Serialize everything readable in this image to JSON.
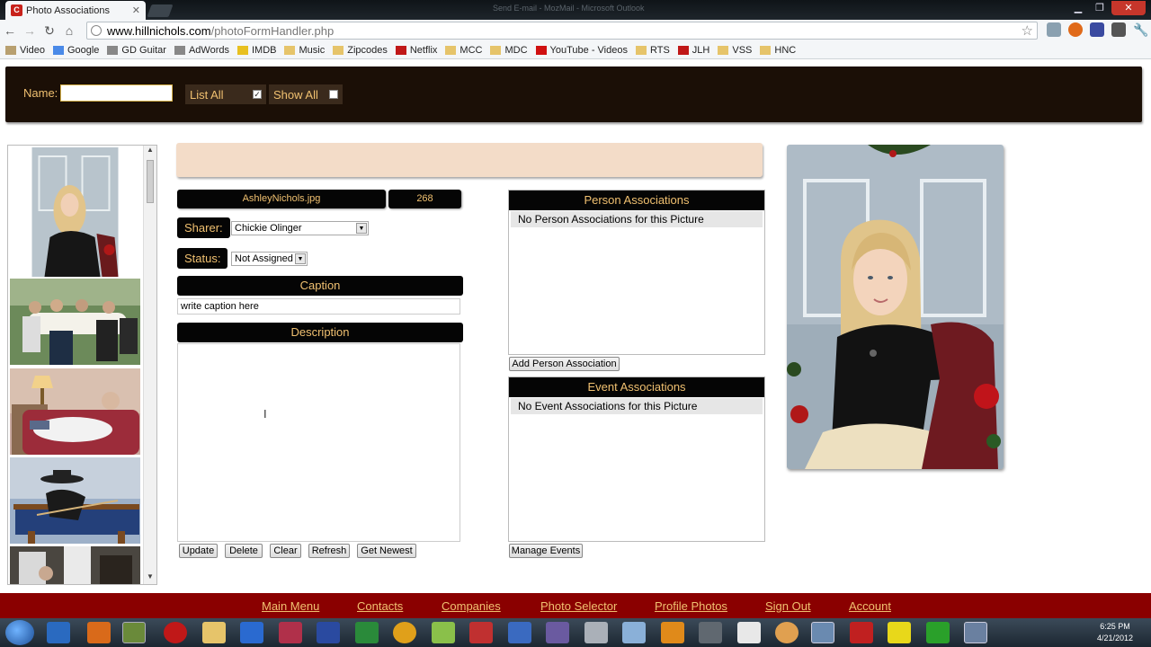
{
  "browser": {
    "tab_title": "Photo Associations",
    "background_title": "Send E-mail - MozMail - Microsoft Outlook",
    "url_host": "www.hillnichols.com",
    "url_path": "/photoFormHandler.php",
    "bookmarks": [
      "Video",
      "Google",
      "GD Guitar",
      "AdWords",
      "IMDB",
      "Music",
      "Zipcodes",
      "Netflix",
      "MCC",
      "MDC",
      "YouTube - Videos",
      "RTS",
      "JLH",
      "VSS",
      "HNC"
    ]
  },
  "toolbar": {
    "name_label": "Name:",
    "name_value": "",
    "list_all_label": "List All",
    "list_all_checked": true,
    "show_all_label": "Show All",
    "show_all_checked": false
  },
  "photo": {
    "filename": "AshleyNichols.jpg",
    "id": "268",
    "sharer_label": "Sharer:",
    "sharer_value": "Chickie Olinger",
    "status_label": "Status:",
    "status_value": "Not Assigned",
    "caption_header": "Caption",
    "caption_value": "write caption here",
    "description_header": "Description",
    "description_value": ""
  },
  "actions": {
    "update": "Update",
    "delete": "Delete",
    "clear": "Clear",
    "refresh": "Refresh",
    "get_newest": "Get Newest"
  },
  "person_assoc": {
    "header": "Person Associations",
    "empty_text": "No Person Associations for this Picture",
    "add_button": "Add Person Association"
  },
  "event_assoc": {
    "header": "Event Associations",
    "empty_text": "No Event Associations for this Picture",
    "manage_button": "Manage Events"
  },
  "footer_nav": [
    "Main Menu",
    "Contacts",
    "Companies",
    "Photo Selector",
    "Profile Photos",
    "Sign Out",
    "Account"
  ],
  "clock": {
    "time": "6:25 PM",
    "date": "4/21/2012"
  },
  "colors": {
    "accent_gold": "#f0c070",
    "header_black": "#050505",
    "footer_red": "#8a0000",
    "banner_peach": "#f3dcc8"
  }
}
